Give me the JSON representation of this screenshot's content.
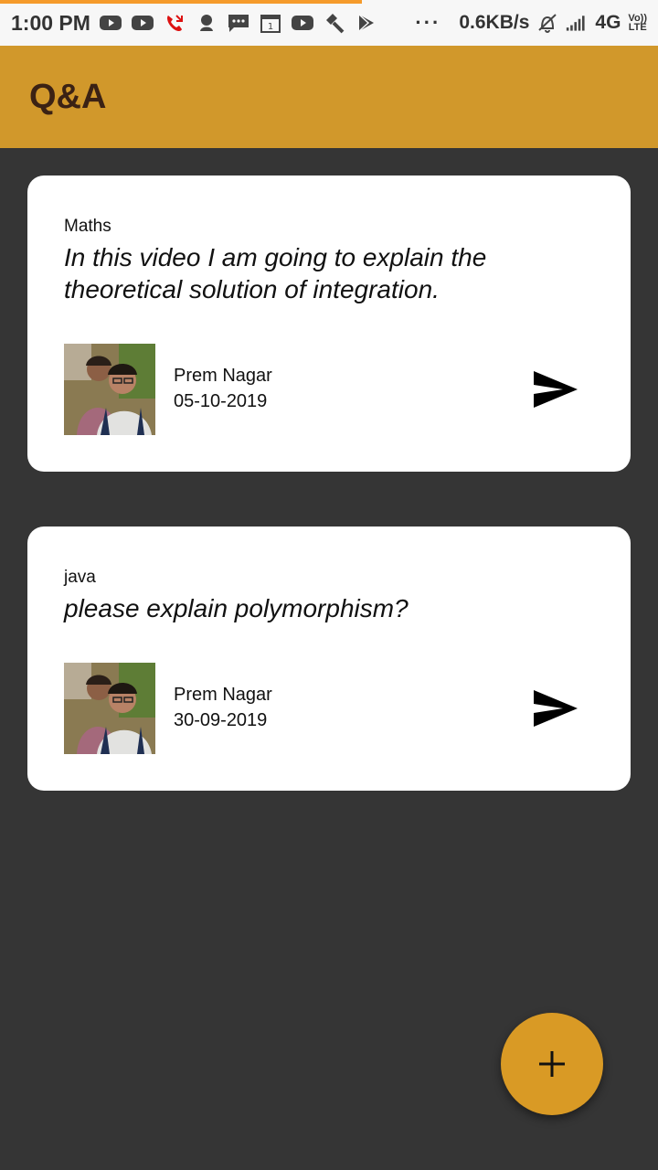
{
  "status_bar": {
    "time": "1:00 PM",
    "speed": "0.6KB/s",
    "network": "4G",
    "volte_top": "Vo))",
    "volte_bottom": "LTE",
    "dots": "···",
    "progress": 0.55
  },
  "app_bar": {
    "title": "Q&A"
  },
  "posts": [
    {
      "subject": "Maths",
      "question": "In this video I am going to explain the theoretical solution of integration.",
      "author": "Prem Nagar",
      "date": "05-10-2019"
    },
    {
      "subject": "java",
      "question": "please explain polymorphism?",
      "author": "Prem Nagar",
      "date": "30-09-2019"
    }
  ],
  "fab": {
    "icon": "plus-icon"
  },
  "colors": {
    "accent": "#d1982b",
    "background": "#353535",
    "title": "#3b2214"
  }
}
